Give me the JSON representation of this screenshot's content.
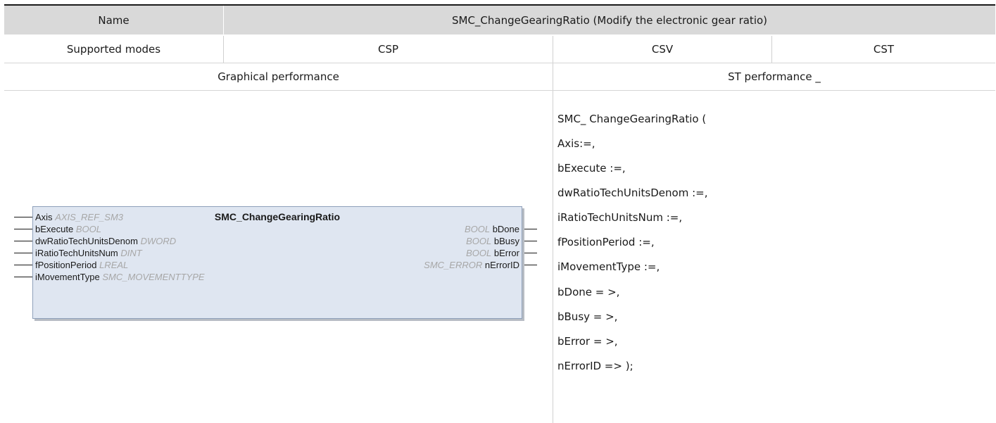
{
  "header": {
    "name_label": "Name",
    "name_value": "SMC_ChangeGearingRatio (Modify the electronic gear ratio)"
  },
  "modes": {
    "label": "Supported modes",
    "csp": "CSP",
    "csv": "CSV",
    "cst": "CST"
  },
  "sections": {
    "graphical": "Graphical performance",
    "st": "ST performance _"
  },
  "function_block": {
    "title": "SMC_ChangeGearingRatio",
    "inputs": [
      {
        "name": "Axis",
        "type": "AXIS_REF_SM3"
      },
      {
        "name": "bExecute",
        "type": "BOOL"
      },
      {
        "name": "dwRatioTechUnitsDenom",
        "type": "DWORD"
      },
      {
        "name": "iRatioTechUnitsNum",
        "type": "DINT"
      },
      {
        "name": "fPositionPeriod",
        "type": "LREAL"
      },
      {
        "name": "iMovementType",
        "type": "SMC_MOVEMENTTYPE"
      }
    ],
    "outputs": [
      {
        "name": "bDone",
        "type": "BOOL"
      },
      {
        "name": "bBusy",
        "type": "BOOL"
      },
      {
        "name": "bError",
        "type": "BOOL"
      },
      {
        "name": "nErrorID",
        "type": "SMC_ERROR"
      }
    ]
  },
  "st_code": [
    "SMC_ ChangeGearingRatio (",
    "Axis:=,",
    "bExecute :=,",
    "dwRatioTechUnitsDenom :=,",
    "iRatioTechUnitsNum :=,",
    "fPositionPeriod :=,",
    "iMovementType :=,",
    "bDone = >,",
    "bBusy = >,",
    "bError = >,",
    "nErrorID => );"
  ]
}
